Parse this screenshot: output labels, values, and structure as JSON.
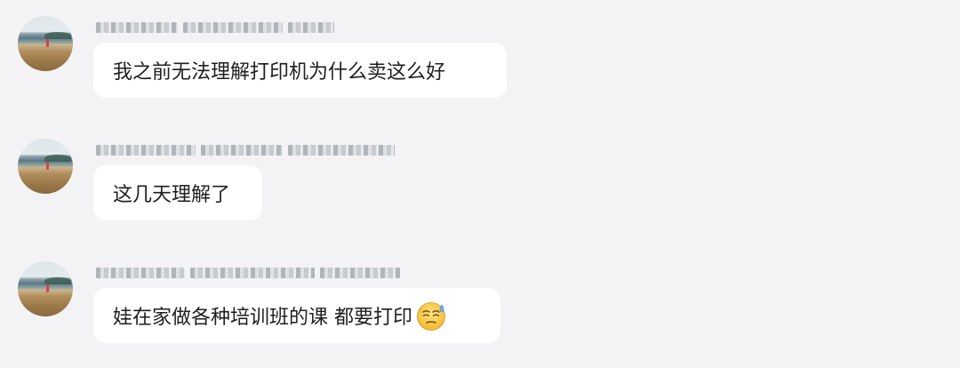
{
  "messages": [
    {
      "text": "我之前无法理解打印机为什么卖这么好"
    },
    {
      "text": "这几天理解了"
    },
    {
      "text": "娃在家做各种培训班的课 都要打印",
      "emoji": "weary-sweat-face"
    }
  ],
  "colors": {
    "background": "#f3f3f5",
    "bubble": "#ffffff",
    "text": "#1f1f1f"
  }
}
